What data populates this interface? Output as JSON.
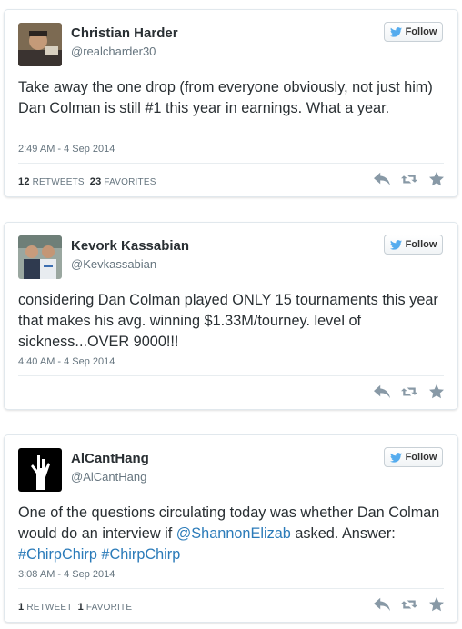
{
  "follow_label": "Follow",
  "tweets": [
    {
      "name": "Christian Harder",
      "handle": "@realcharder30",
      "text": "Take away the one drop (from everyone obviously, not just him) Dan Colman is still #1 this year in earnings. What a year.",
      "timestamp": "2:49 AM - 4 Sep 2014",
      "retweets_count": "12",
      "retweets_label": "RETWEETS",
      "favorites_count": "23",
      "favorites_label": "FAVORITES"
    },
    {
      "name": "Kevork Kassabian",
      "handle": "@Kevkassabian",
      "text": "considering Dan Colman played ONLY 15 tournaments this year that makes his avg. winning $1.33M/tourney. level of sickness...OVER 9000!!!",
      "timestamp": "4:40 AM - 4 Sep 2014"
    },
    {
      "name": "AlCantHang",
      "handle": "@AlCantHang",
      "text_part1": "One of the questions circulating today was whether Dan Colman would do an interview if ",
      "mention": "@ShannonElizab",
      "text_part2": " asked. Answer: ",
      "hashtag1": "#ChirpChirp",
      "hashtag2": "#ChirpChirp",
      "timestamp": "3:08 AM - 4 Sep 2014",
      "retweets_count": "1",
      "retweets_label": "RETWEET",
      "favorites_count": "1",
      "favorites_label": "FAVORITE"
    }
  ],
  "icons": {
    "bird": "twitter-bird-icon",
    "reply": "reply-icon",
    "retweet": "retweet-icon",
    "favorite": "star-icon"
  },
  "colors": {
    "link": "#2b7bb9",
    "bird": "#55acee",
    "action_icon": "#8899a6"
  }
}
